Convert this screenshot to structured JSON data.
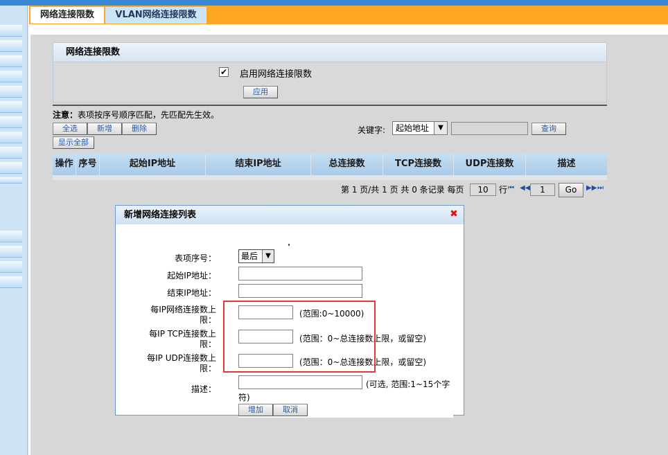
{
  "tabs": [
    {
      "label": "网络连接限数"
    },
    {
      "label": "VLAN网络连接限数"
    }
  ],
  "panel": {
    "title": "网络连接限数",
    "enable_label": "启用网络连接限数",
    "enable_checked": true,
    "apply_label": "应用"
  },
  "note": {
    "prefix": "注意：",
    "text": "表项按序号顺序匹配，先匹配先生效。"
  },
  "toolbar": {
    "select_all": "全选",
    "add": "新增",
    "delete": "删除",
    "show_all": "显示全部",
    "keyword_label": "关键字:",
    "keyword_select": "起始地址",
    "keyword_value": "",
    "search": "查询"
  },
  "table": {
    "columns": [
      "操作",
      "序号",
      "起始IP地址",
      "结束IP地址",
      "总连接数",
      "TCP连接数",
      "UDP连接数",
      "描述"
    ]
  },
  "pagination": {
    "summary": "第 1 页/共 1 页 共 0 条记录 每页",
    "page_size": "10",
    "row_label": "行",
    "current_page": "1",
    "go_label": "Go"
  },
  "dialog": {
    "title": "新增网络连接列表",
    "fields": {
      "index_label": "表项序号：",
      "index_value": "最后",
      "start_ip_label": "起始IP地址：",
      "end_ip_label": "结束IP地址：",
      "per_ip_conn_label1": "每IP网络连接数上",
      "per_ip_conn_label2": "限：",
      "per_ip_conn_hint": "(范围:0~10000)",
      "per_ip_tcp_label1": "每IP TCP连接数上",
      "per_ip_tcp_label2": "限：",
      "per_ip_tcp_hint": "(范围：0~总连接数上限，或留空)",
      "per_ip_udp_label1": "每IP UDP连接数上",
      "per_ip_udp_label2": "限：",
      "per_ip_udp_hint": "(范围：0~总连接数上限，或留空)",
      "desc_label": "描述：",
      "desc_hint1": "(可选, 范围:1~15个字",
      "desc_hint2": "符)"
    },
    "add_button": "增加",
    "cancel_button": "取消"
  },
  "colors": {
    "tab_bar": "#fda724",
    "highlight_box": "#e53935",
    "header_blue": "#a9cbe8"
  }
}
